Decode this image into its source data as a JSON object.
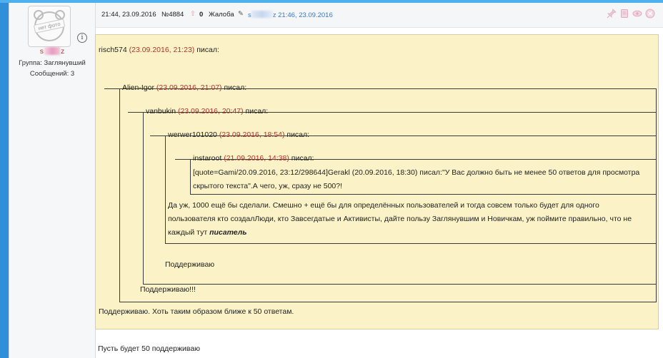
{
  "sidebar": {
    "avatar_text": "нет фото",
    "username_start": "s",
    "username_end": "z",
    "group": "Группа: Заглянувший",
    "messages": "Сообщений: 3"
  },
  "header": {
    "datetime": "21:44, 23.09.2016",
    "post_number": "№4884",
    "rating": "0",
    "complaint": "Жалоба",
    "editor_start": "s",
    "editor_end": "z",
    "edited_at": "21:46, 23.09.2016",
    "icons": [
      "pin-icon",
      "document-icon",
      "eye-icon",
      "close-circle-icon"
    ]
  },
  "quote1": {
    "author": "risch574",
    "date": "(23.09.2016, 21:23)",
    "suffix": " писал:"
  },
  "quote2": {
    "author": "Alien-Igor",
    "date": "(23.09.2016, 21:07)",
    "suffix": " писал:"
  },
  "quote3": {
    "author": "vanbukin",
    "date": "(23.09.2016, 20:47)",
    "suffix": " писал:"
  },
  "quote4": {
    "author": "werwer101020",
    "date": "(23.09.2016, 18:54)",
    "suffix": " писал:"
  },
  "quote5": {
    "author": "instaroot",
    "date": "(21.09.2016, 14:38)",
    "suffix": " писал:",
    "line1": "[quote=Gami/20.09.2016, 23:12/298644]Gerakl (20.09.2016, 18:30) писал:\"У Вас должно быть не менее 50 ответов для просмотра",
    "line2": "скрытого текста\".А чего, уж, сразу не 500?!"
  },
  "werwer_text": {
    "line1": "Да уж, 1000 ещё бы сделали. Смешно + ещё бы для определённых пользователей и тогда совсем только будет для одного",
    "line2": "пользователя кто создалЛюди, кто Завсегдатые и Активисты, дайте пользу Заглянувшим и Новичкам, уж поймите правильно, что не",
    "line3_prefix": "каждый тут ",
    "line3_bold": "писатель"
  },
  "vanbukin_text": "Поддерживаю",
  "alien_text": "Поддерживаю!!!",
  "risch_text": "Поддерживаю. Хоть таким образом ближе к 50 ответам.",
  "reply_text": "Пусть будет 50 поддерживаю"
}
